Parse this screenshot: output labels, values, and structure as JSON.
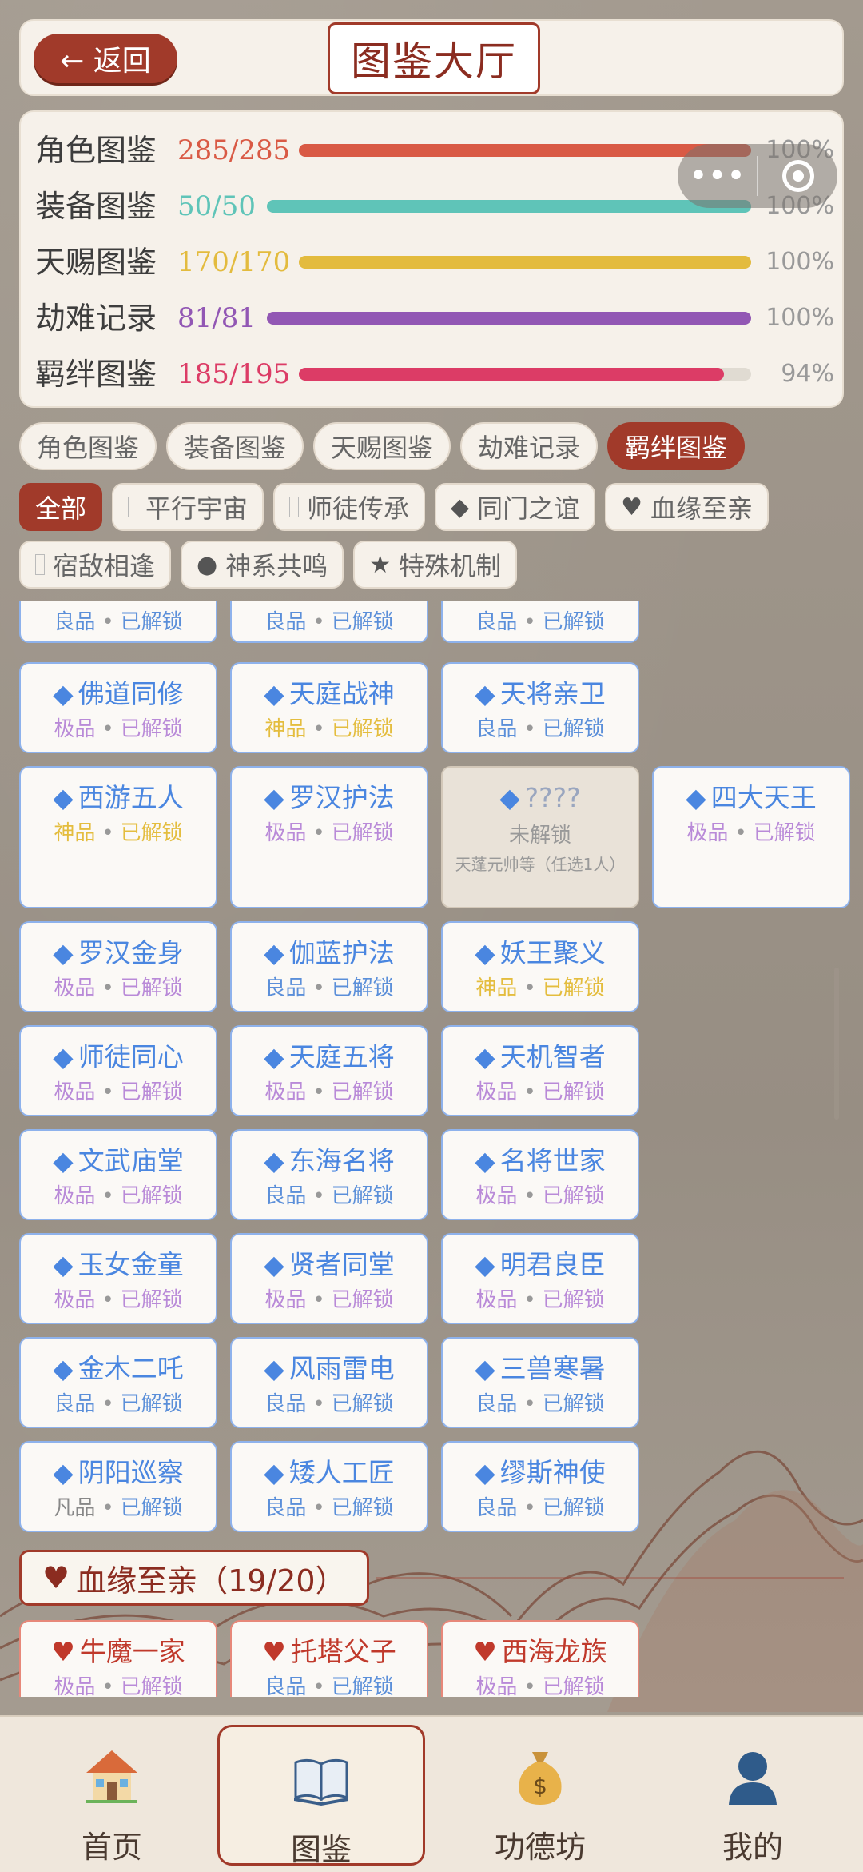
{
  "header": {
    "back_label": "← 返回",
    "title": "图鉴大厅"
  },
  "stats": [
    {
      "label": "角色图鉴",
      "count": "285/285",
      "percent": "100%",
      "fill": 1.0,
      "color": "#d95a45"
    },
    {
      "label": "装备图鉴",
      "count": "50/50",
      "percent": "100%",
      "fill": 1.0,
      "color": "#5fc4b8"
    },
    {
      "label": "天赐图鉴",
      "count": "170/170",
      "percent": "100%",
      "fill": 1.0,
      "color": "#e3bb3e"
    },
    {
      "label": "劫难记录",
      "count": "81/81",
      "percent": "100%",
      "fill": 1.0,
      "color": "#9257b4"
    },
    {
      "label": "羁绊图鉴",
      "count": "185/195",
      "percent": "94%",
      "fill": 0.94,
      "color": "#dc3c66"
    }
  ],
  "capsule": {
    "menu_label": "•••"
  },
  "category_tabs": [
    "角色图鉴",
    "装备图鉴",
    "天赐图鉴",
    "劫难记录",
    "羁绊图鉴"
  ],
  "active_category": "羁绊图鉴",
  "filters_row1": [
    {
      "label": "全部",
      "icon": "",
      "active": true
    },
    {
      "label": "平行宇宙",
      "icon": "box-icon"
    },
    {
      "label": "师徒传承",
      "icon": "box-icon"
    },
    {
      "label": "同门之谊",
      "icon": "diamond-icon"
    },
    {
      "label": "血缘至亲",
      "icon": "heart-icon"
    }
  ],
  "filters_row2": [
    {
      "label": "宿敌相逢",
      "icon": "box-icon"
    },
    {
      "label": "神系共鸣",
      "icon": "circle-icon"
    },
    {
      "label": "特殊机制",
      "icon": "star-icon"
    }
  ],
  "cards_top_partial": [
    {
      "rarity": "良品",
      "status": "已解锁",
      "r": "liang"
    },
    {
      "rarity": "良品",
      "status": "已解锁",
      "r": "liang"
    },
    {
      "rarity": "良品",
      "status": "已解锁",
      "r": "liang"
    }
  ],
  "cards": [
    [
      {
        "name": "佛道同修",
        "rarity": "极品",
        "status": "已解锁",
        "r": "ji"
      },
      {
        "name": "天庭战神",
        "rarity": "神品",
        "status": "已解锁",
        "r": "shen"
      },
      {
        "name": "天将亲卫",
        "rarity": "良品",
        "status": "已解锁",
        "r": "liang"
      }
    ],
    [
      {
        "name": "西游五人",
        "rarity": "神品",
        "status": "已解锁",
        "r": "shen"
      },
      {
        "name": "罗汉护法",
        "rarity": "极品",
        "status": "已解锁",
        "r": "ji"
      },
      {
        "name": "????",
        "locked": true,
        "status": "未解锁",
        "hint": "天蓬元帅等（任选1人）"
      },
      {
        "name": "四大天王",
        "rarity": "极品",
        "status": "已解锁",
        "r": "ji"
      }
    ],
    [
      {
        "name": "罗汉金身",
        "rarity": "极品",
        "status": "已解锁",
        "r": "ji"
      },
      {
        "name": "伽蓝护法",
        "rarity": "良品",
        "status": "已解锁",
        "r": "liang"
      },
      {
        "name": "妖王聚义",
        "rarity": "神品",
        "status": "已解锁",
        "r": "shen"
      }
    ],
    [
      {
        "name": "师徒同心",
        "rarity": "极品",
        "status": "已解锁",
        "r": "ji"
      },
      {
        "name": "天庭五将",
        "rarity": "极品",
        "status": "已解锁",
        "r": "ji"
      },
      {
        "name": "天机智者",
        "rarity": "极品",
        "status": "已解锁",
        "r": "ji"
      }
    ],
    [
      {
        "name": "文武庙堂",
        "rarity": "极品",
        "status": "已解锁",
        "r": "ji"
      },
      {
        "name": "东海名将",
        "rarity": "良品",
        "status": "已解锁",
        "r": "liang"
      },
      {
        "name": "名将世家",
        "rarity": "极品",
        "status": "已解锁",
        "r": "ji"
      }
    ],
    [
      {
        "name": "玉女金童",
        "rarity": "极品",
        "status": "已解锁",
        "r": "ji"
      },
      {
        "name": "贤者同堂",
        "rarity": "极品",
        "status": "已解锁",
        "r": "ji"
      },
      {
        "name": "明君良臣",
        "rarity": "极品",
        "status": "已解锁",
        "r": "ji"
      }
    ],
    [
      {
        "name": "金木二吒",
        "rarity": "良品",
        "status": "已解锁",
        "r": "liang"
      },
      {
        "name": "风雨雷电",
        "rarity": "良品",
        "status": "已解锁",
        "r": "liang"
      },
      {
        "name": "三兽寒暑",
        "rarity": "良品",
        "status": "已解锁",
        "r": "liang"
      }
    ],
    [
      {
        "name": "阴阳巡察",
        "rarity": "凡品",
        "status": "已解锁",
        "r": "fan"
      },
      {
        "name": "矮人工匠",
        "rarity": "良品",
        "status": "已解锁",
        "r": "liang"
      },
      {
        "name": "缪斯神使",
        "rarity": "良品",
        "status": "已解锁",
        "r": "liang"
      }
    ]
  ],
  "section": {
    "title": "血缘至亲（19/20）"
  },
  "section_cards": [
    {
      "name": "牛魔一家",
      "rarity": "极品",
      "status": "已解锁",
      "r": "ji"
    },
    {
      "name": "托塔父子",
      "rarity": "良品",
      "status": "已解锁",
      "r": "liang"
    },
    {
      "name": "西海龙族",
      "rarity": "极品",
      "status": "已解锁",
      "r": "ji"
    }
  ],
  "bottom_nav": [
    {
      "label": "首页",
      "icon": "house-icon"
    },
    {
      "label": "图鉴",
      "icon": "book-icon",
      "active": true
    },
    {
      "label": "功德坊",
      "icon": "money-bag-icon"
    },
    {
      "label": "我的",
      "icon": "user-icon"
    }
  ]
}
